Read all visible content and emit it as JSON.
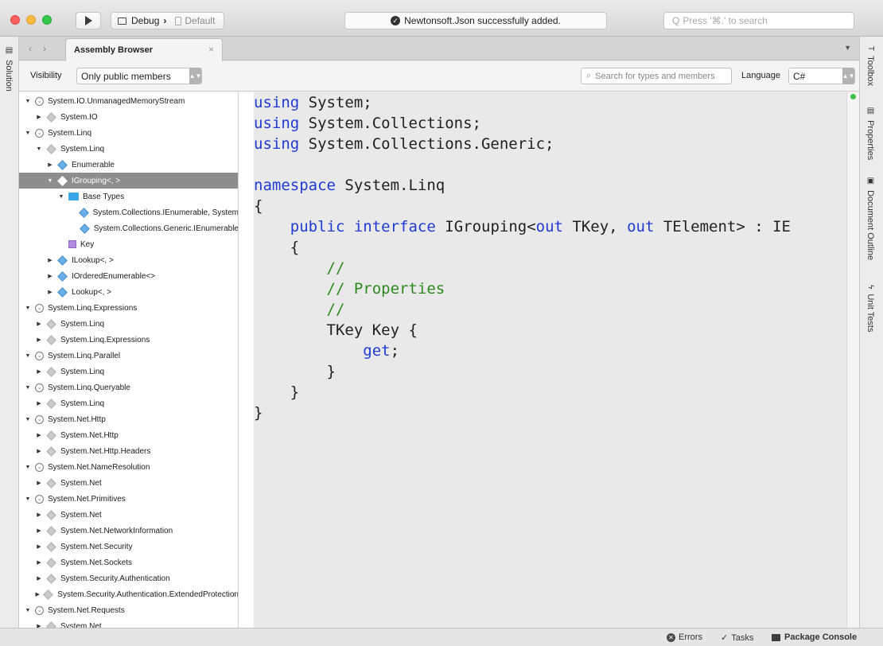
{
  "toolbar": {
    "config": "Debug",
    "target": "Default",
    "status_message": "Newtonsoft.Json successfully added.",
    "search_placeholder": "Press '⌘.' to search"
  },
  "left_pads": {
    "solution": "Solution"
  },
  "right_pads": {
    "toolbox": "Toolbox",
    "properties": "Properties",
    "document_outline": "Document Outline",
    "unit_tests": "Unit Tests"
  },
  "document_tab": {
    "label": "Assembly Browser",
    "close": "×"
  },
  "options": {
    "visibility_label": "Visibility",
    "visibility_value": "Only public members",
    "search_placeholder": "Search for types and members",
    "language_label": "Language",
    "language_value": "C#"
  },
  "tree": [
    {
      "label": "System.IO.UnmanagedMemoryStream",
      "level": 0,
      "icon": "assembly-icon",
      "state": "expanded"
    },
    {
      "label": "System.IO",
      "level": 1,
      "icon": "namespace-icon",
      "state": "collapsed"
    },
    {
      "label": "System.Linq",
      "level": 0,
      "icon": "assembly-icon",
      "state": "expanded"
    },
    {
      "label": "System.Linq",
      "level": 1,
      "icon": "namespace-icon",
      "state": "expanded"
    },
    {
      "label": "Enumerable",
      "level": 2,
      "icon": "class-icon",
      "state": "collapsed"
    },
    {
      "label": "IGrouping<, >",
      "level": 2,
      "icon": "class-icon",
      "state": "expanded",
      "selected": true
    },
    {
      "label": "Base Types",
      "level": 3,
      "icon": "folder-icon",
      "state": "expanded"
    },
    {
      "label": "System.Collections.IEnumerable, System",
      "level": 4,
      "icon": "class-icon",
      "state": "leaf"
    },
    {
      "label": "System.Collections.Generic.IEnumerable",
      "level": 4,
      "icon": "class-icon",
      "state": "leaf"
    },
    {
      "label": "Key",
      "level": 3,
      "icon": "property-icon",
      "state": "leaf"
    },
    {
      "label": "ILookup<, >",
      "level": 2,
      "icon": "class-icon",
      "state": "collapsed"
    },
    {
      "label": "IOrderedEnumerable<>",
      "level": 2,
      "icon": "class-icon",
      "state": "collapsed"
    },
    {
      "label": "Lookup<, >",
      "level": 2,
      "icon": "class-icon",
      "state": "collapsed"
    },
    {
      "label": "System.Linq.Expressions",
      "level": 0,
      "icon": "assembly-icon",
      "state": "expanded"
    },
    {
      "label": "System.Linq",
      "level": 1,
      "icon": "namespace-icon",
      "state": "collapsed"
    },
    {
      "label": "System.Linq.Expressions",
      "level": 1,
      "icon": "namespace-icon",
      "state": "collapsed"
    },
    {
      "label": "System.Linq.Parallel",
      "level": 0,
      "icon": "assembly-icon",
      "state": "expanded"
    },
    {
      "label": "System.Linq",
      "level": 1,
      "icon": "namespace-icon",
      "state": "collapsed"
    },
    {
      "label": "System.Linq.Queryable",
      "level": 0,
      "icon": "assembly-icon",
      "state": "expanded"
    },
    {
      "label": "System.Linq",
      "level": 1,
      "icon": "namespace-icon",
      "state": "collapsed"
    },
    {
      "label": "System.Net.Http",
      "level": 0,
      "icon": "assembly-icon",
      "state": "expanded"
    },
    {
      "label": "System.Net.Http",
      "level": 1,
      "icon": "namespace-icon",
      "state": "collapsed"
    },
    {
      "label": "System.Net.Http.Headers",
      "level": 1,
      "icon": "namespace-icon",
      "state": "collapsed"
    },
    {
      "label": "System.Net.NameResolution",
      "level": 0,
      "icon": "assembly-icon",
      "state": "expanded"
    },
    {
      "label": "System.Net",
      "level": 1,
      "icon": "namespace-icon",
      "state": "collapsed"
    },
    {
      "label": "System.Net.Primitives",
      "level": 0,
      "icon": "assembly-icon",
      "state": "expanded"
    },
    {
      "label": "System.Net",
      "level": 1,
      "icon": "namespace-icon",
      "state": "collapsed"
    },
    {
      "label": "System.Net.NetworkInformation",
      "level": 1,
      "icon": "namespace-icon",
      "state": "collapsed"
    },
    {
      "label": "System.Net.Security",
      "level": 1,
      "icon": "namespace-icon",
      "state": "collapsed"
    },
    {
      "label": "System.Net.Sockets",
      "level": 1,
      "icon": "namespace-icon",
      "state": "collapsed"
    },
    {
      "label": "System.Security.Authentication",
      "level": 1,
      "icon": "namespace-icon",
      "state": "collapsed"
    },
    {
      "label": "System.Security.Authentication.ExtendedProtection",
      "level": 1,
      "icon": "namespace-icon",
      "state": "collapsed"
    },
    {
      "label": "System.Net.Requests",
      "level": 0,
      "icon": "assembly-icon",
      "state": "expanded"
    },
    {
      "label": "System.Net",
      "level": 1,
      "icon": "namespace-icon",
      "state": "collapsed"
    }
  ],
  "code": [
    [
      {
        "t": "using",
        "k": "kw"
      },
      {
        "t": " System;"
      }
    ],
    [
      {
        "t": "using",
        "k": "kw"
      },
      {
        "t": " System.Collections;"
      }
    ],
    [
      {
        "t": "using",
        "k": "kw"
      },
      {
        "t": " System.Collections.Generic;"
      }
    ],
    [
      {
        "t": ""
      }
    ],
    [
      {
        "t": "namespace",
        "k": "kw"
      },
      {
        "t": " System.Linq"
      }
    ],
    [
      {
        "t": "{"
      }
    ],
    [
      {
        "t": "    "
      },
      {
        "t": "public",
        "k": "kw"
      },
      {
        "t": " "
      },
      {
        "t": "interface",
        "k": "kw"
      },
      {
        "t": " IGrouping<"
      },
      {
        "t": "out",
        "k": "kw"
      },
      {
        "t": " TKey, "
      },
      {
        "t": "out",
        "k": "kw"
      },
      {
        "t": " TElement> : IE"
      }
    ],
    [
      {
        "t": "    {"
      }
    ],
    [
      {
        "t": "        "
      },
      {
        "t": "//",
        "k": "cm"
      }
    ],
    [
      {
        "t": "        "
      },
      {
        "t": "// Properties",
        "k": "cm"
      }
    ],
    [
      {
        "t": "        "
      },
      {
        "t": "//",
        "k": "cm"
      }
    ],
    [
      {
        "t": "        TKey Key {"
      }
    ],
    [
      {
        "t": "            "
      },
      {
        "t": "get",
        "k": "kw"
      },
      {
        "t": ";"
      }
    ],
    [
      {
        "t": "        }"
      }
    ],
    [
      {
        "t": "    }"
      }
    ],
    [
      {
        "t": "}"
      }
    ]
  ],
  "statusbar": {
    "errors": "Errors",
    "tasks": "Tasks",
    "package_console": "Package Console"
  },
  "colors": {
    "keyword": "#1f3ad6",
    "comment": "#2e8a1f",
    "selection": "#8e8e8e",
    "success_dot": "#40c04a"
  }
}
